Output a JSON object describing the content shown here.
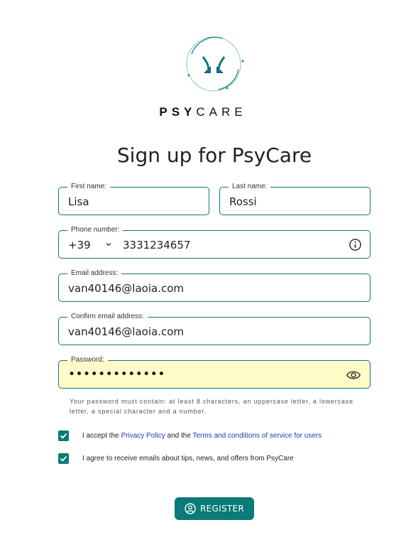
{
  "brand": {
    "part1": "PSY",
    "part2": "CARE"
  },
  "title": "Sign up for PsyCare",
  "fields": {
    "first_name": {
      "label": "First name:",
      "value": "Lisa"
    },
    "last_name": {
      "label": "Last name:",
      "value": "Rossi"
    },
    "phone": {
      "label": "Phone number:",
      "prefix": "+39",
      "value": "3331234657"
    },
    "email": {
      "label": "Email address:",
      "value": "van40146@laoia.com"
    },
    "confirm_email": {
      "label": "Confirm email address:",
      "value": "van40146@laoia.com"
    },
    "password": {
      "label": "Password:",
      "masked": "•••••••••••••"
    }
  },
  "password_hint": "Your password must contain: at least 8 characters, an uppercase letter, a lowercase letter, a special character and a number.",
  "consents": {
    "privacy": {
      "prefix": "I accept the ",
      "link1": "Privacy Policy",
      "middle": " and the ",
      "link2": "Terms and conditions of service for users",
      "checked": true
    },
    "emails": {
      "text": "I agree to receive emails about tips, news, and offers from PsyCare",
      "checked": true
    }
  },
  "register_label": "REGISTER",
  "colors": {
    "accent": "#0b7a78",
    "autofill": "#fdfbc6",
    "link": "#1a3ea8"
  },
  "icons": [
    "psycare-logo-icon",
    "chevron-down-icon",
    "info-icon",
    "eye-icon",
    "checkmark-icon",
    "user-circle-icon"
  ]
}
